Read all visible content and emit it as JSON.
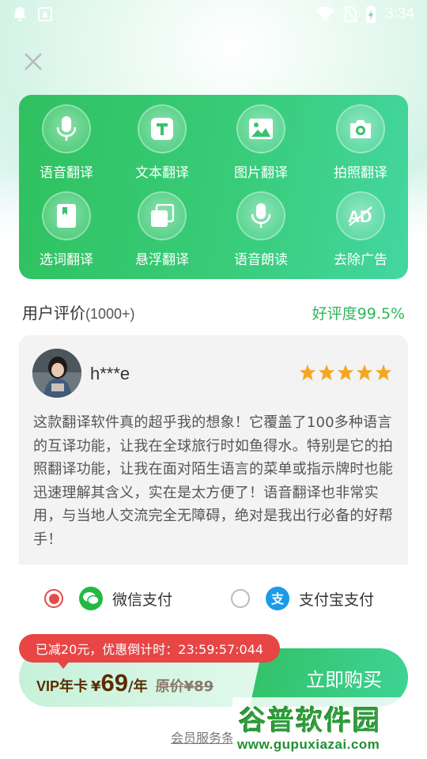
{
  "status_bar": {
    "time": "3:34"
  },
  "features": [
    {
      "label": "语音翻译",
      "icon": "microphone-icon"
    },
    {
      "label": "文本翻译",
      "icon": "text-t-icon"
    },
    {
      "label": "图片翻译",
      "icon": "image-icon"
    },
    {
      "label": "拍照翻译",
      "icon": "camera-icon"
    },
    {
      "label": "选词翻译",
      "icon": "bookmark-book-icon"
    },
    {
      "label": "悬浮翻译",
      "icon": "floating-window-icon"
    },
    {
      "label": "语音朗读",
      "icon": "microphone-icon"
    },
    {
      "label": "去除广告",
      "icon": "no-ad-icon"
    }
  ],
  "reviews": {
    "title": "用户评价",
    "count": "(1000+)",
    "rating": "好评度99.5%",
    "item": {
      "username": "h***e",
      "stars": 5,
      "text": "这款翻译软件真的超乎我的想象！它覆盖了100多种语言的互译功能，让我在全球旅行时如鱼得水。特别是它的拍照翻译功能，让我在面对陌生语言的菜单或指示牌时也能迅速理解其含义，实在是太方便了！语音翻译也非常实用，与当地人交流完全无障碍，绝对是我出行必备的好帮手！"
    }
  },
  "payment": {
    "wechat_label": "微信支付",
    "alipay_label": "支付宝支付",
    "selected": "wechat"
  },
  "purchase": {
    "countdown": "已减20元，优惠倒计时：23:59:57:044",
    "vip_label": "VIP年卡",
    "currency": "¥",
    "price": "69",
    "unit": "/年",
    "original_price": "原价¥89",
    "buy_label": "立即购买",
    "service_link": "会员服务条"
  },
  "watermark": {
    "title": "谷普软件园",
    "url": "www.gupuxiazai.com"
  },
  "colors": {
    "primary_green": "#2fc15f",
    "rating_green": "#2fb55b",
    "star": "#f5a623",
    "countdown_red": "#e84545",
    "price_brown": "#5a2c00"
  }
}
